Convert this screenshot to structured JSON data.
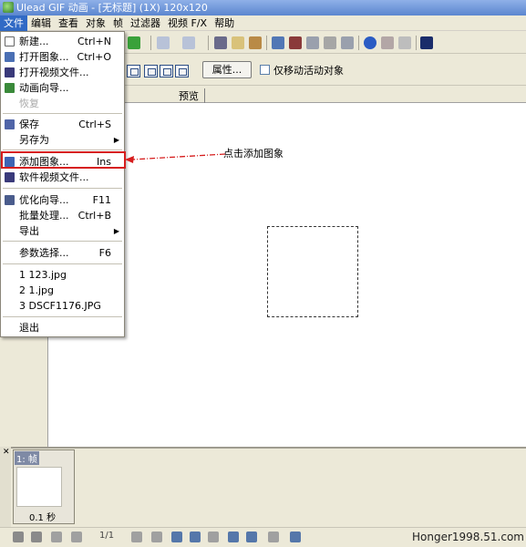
{
  "window": {
    "title": "Ulead GIF 动画 - [无标题] (1X) 120x120"
  },
  "menubar": {
    "items": [
      "文件",
      "编辑",
      "查看",
      "对象",
      "帧",
      "过滤器",
      "视频 F/X",
      "帮助"
    ]
  },
  "toolbar2": {
    "properties_label": "属性...",
    "checkbox_label": "仅移动活动对象"
  },
  "tabs": {
    "preview_label": "预览"
  },
  "file_menu": {
    "new_label": "新建...",
    "new_shortcut": "Ctrl+N",
    "open_image_label": "打开图象...",
    "open_image_shortcut": "Ctrl+O",
    "open_video_label": "打开视频文件...",
    "animation_wizard_label": "动画向导...",
    "restore_label": "恢复",
    "save_label": "保存",
    "save_shortcut": "Ctrl+S",
    "save_as_label": "另存为",
    "add_image_label": "添加图象...",
    "add_image_shortcut": "Ins",
    "software_video_label": "软件视频文件...",
    "optimize_label": "优化向导...",
    "optimize_shortcut": "F11",
    "batch_label": "批量处理...",
    "batch_shortcut": "Ctrl+B",
    "export_label": "导出",
    "prefs_label": "参数选择...",
    "prefs_shortcut": "F6",
    "recent_1": "1 123.jpg",
    "recent_2": "2 1.jpg",
    "recent_3": "3 DSCF1176.JPG",
    "exit_label": "退出"
  },
  "annotation": {
    "text": "点击添加图象",
    "color": "#d61d1d"
  },
  "frame_panel": {
    "frame_label": "1: 帧",
    "delay": "0.1 秒"
  },
  "statusbar": {
    "frame_counter": "1/1"
  },
  "watermark": {
    "text": "Honger1998.51.com"
  }
}
